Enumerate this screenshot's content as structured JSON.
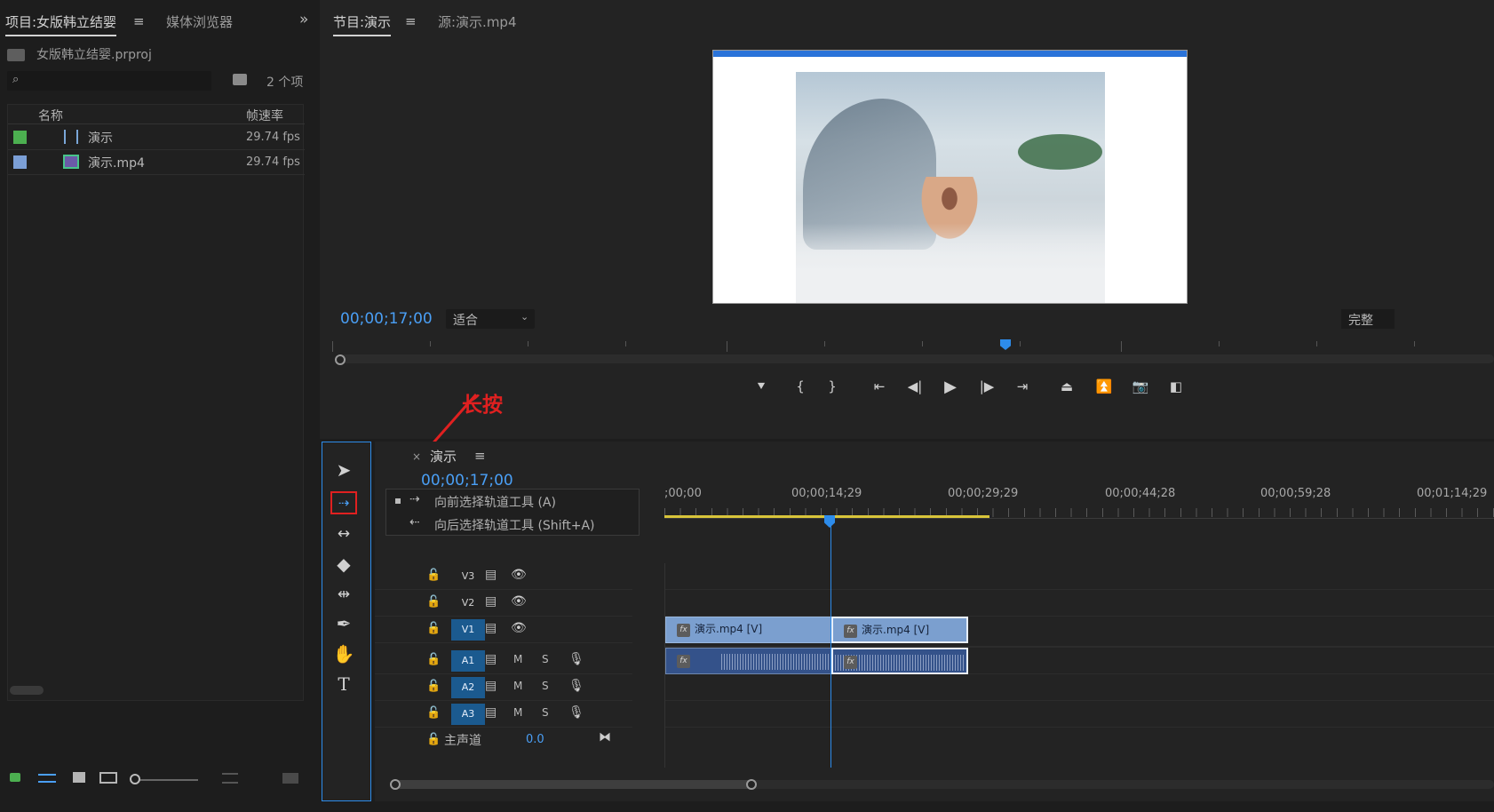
{
  "project_panel": {
    "tab_project": "项目:女版韩立结婴",
    "tab_media_browser": "媒体浏览器",
    "project_file": "女版韩立结婴.prproj",
    "search_placeholder": "",
    "item_count": "2 个项",
    "col_name": "名称",
    "col_framerate": "帧速率",
    "items": [
      {
        "name": "演示",
        "fps": "29.74 fps",
        "color": "#4caf50",
        "icon": "sequence-icon"
      },
      {
        "name": "演示.mp4",
        "fps": "29.74 fps",
        "color": "#7b9fd6",
        "icon": "video-file-icon"
      }
    ]
  },
  "program_monitor": {
    "tab_program": "节目:演示",
    "tab_source": "源:演示.mp4",
    "timecode": "00;00;17;00",
    "zoom": "适合",
    "resolution": "完整"
  },
  "annotation": {
    "text": "长按",
    "color": "#e02020"
  },
  "timeline": {
    "sequence_name": "演示",
    "timecode": "00;00;17;00",
    "ruler_labels": [
      ";00;00",
      "00;00;14;29",
      "00;00;29;29",
      "00;00;44;28",
      "00;00;59;28",
      "00;01;14;29"
    ],
    "video_tracks": [
      "V3",
      "V2",
      "V1"
    ],
    "audio_tracks": [
      "A1",
      "A2",
      "A3"
    ],
    "master_label": "主声道",
    "master_value": "0.0",
    "mute_label": "M",
    "solo_label": "S",
    "clips": {
      "v1a": "演示.mp4 [V]",
      "v1b": "演示.mp4 [V]",
      "fx": "fx"
    }
  },
  "tools_popup": {
    "forward": "向前选择轨道工具 (A)",
    "backward": "向后选择轨道工具 (Shift+A)"
  },
  "colors": {
    "accent_blue": "#2d8ceb",
    "timecode_blue": "#4a9ff5",
    "clip_video": "#7b9fcf",
    "clip_audio": "#34528a"
  }
}
